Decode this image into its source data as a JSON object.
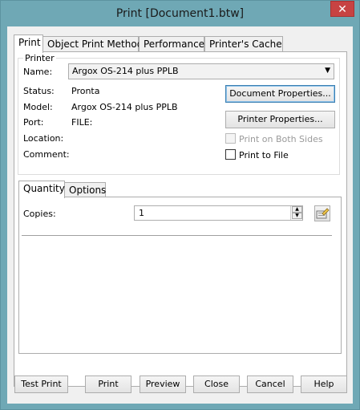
{
  "window": {
    "title": "Print [Document1.btw]",
    "close_glyph": "✕"
  },
  "tabs": [
    {
      "label": "Print",
      "active": true
    },
    {
      "label": "Object Print Method",
      "active": false
    },
    {
      "label": "Performance",
      "active": false
    },
    {
      "label": "Printer's Cache",
      "active": false
    }
  ],
  "printer": {
    "group_label": "Printer",
    "name_label": "Name:",
    "name_value": "Argox OS-214 plus PPLB",
    "status_label": "Status:",
    "status_value": "Pronta",
    "model_label": "Model:",
    "model_value": "Argox OS-214 plus PPLB",
    "port_label": "Port:",
    "port_value": "FILE:",
    "location_label": "Location:",
    "comment_label": "Comment:",
    "document_properties": "Document Properties...",
    "printer_properties": "Printer Properties...",
    "print_both_sides": "Print on Both Sides",
    "print_to_file": "Print to File"
  },
  "subtabs": [
    {
      "label": "Quantity",
      "active": true
    },
    {
      "label": "Options",
      "active": false
    }
  ],
  "quantity": {
    "copies_label": "Copies:",
    "copies_value": "1"
  },
  "footer": {
    "test_print": "Test Print",
    "print": "Print",
    "preview": "Preview",
    "close": "Close",
    "cancel": "Cancel",
    "help": "Help"
  },
  "colors": {
    "frame": "#6fa8b5",
    "close_button": "#c74343",
    "focus_border": "#3c7fb1"
  }
}
